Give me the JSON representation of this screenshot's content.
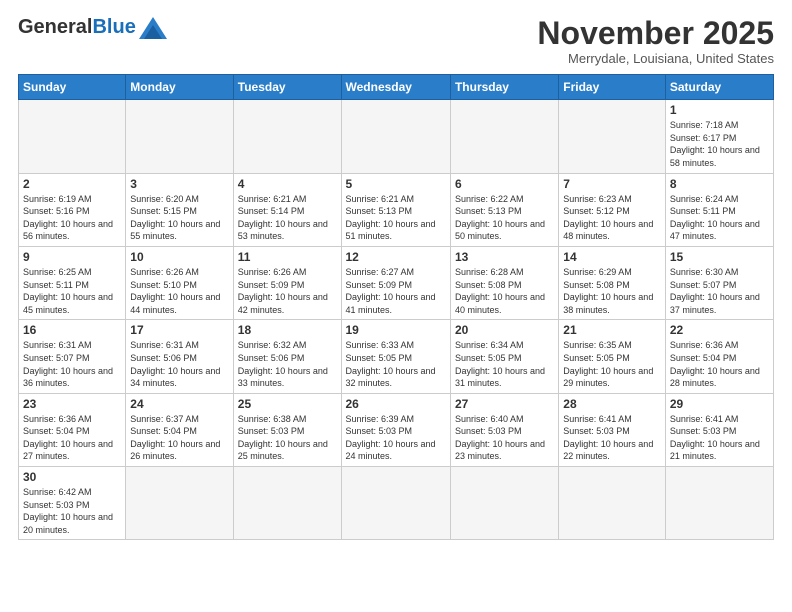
{
  "header": {
    "logo_general": "General",
    "logo_blue": "Blue",
    "month_title": "November 2025",
    "location": "Merrydale, Louisiana, United States"
  },
  "weekdays": [
    "Sunday",
    "Monday",
    "Tuesday",
    "Wednesday",
    "Thursday",
    "Friday",
    "Saturday"
  ],
  "days": {
    "d1": {
      "num": "1",
      "rise": "Sunrise: 7:18 AM",
      "set": "Sunset: 6:17 PM",
      "day": "Daylight: 10 hours and 58 minutes."
    },
    "d2": {
      "num": "2",
      "rise": "Sunrise: 6:19 AM",
      "set": "Sunset: 5:16 PM",
      "day": "Daylight: 10 hours and 56 minutes."
    },
    "d3": {
      "num": "3",
      "rise": "Sunrise: 6:20 AM",
      "set": "Sunset: 5:15 PM",
      "day": "Daylight: 10 hours and 55 minutes."
    },
    "d4": {
      "num": "4",
      "rise": "Sunrise: 6:21 AM",
      "set": "Sunset: 5:14 PM",
      "day": "Daylight: 10 hours and 53 minutes."
    },
    "d5": {
      "num": "5",
      "rise": "Sunrise: 6:21 AM",
      "set": "Sunset: 5:13 PM",
      "day": "Daylight: 10 hours and 51 minutes."
    },
    "d6": {
      "num": "6",
      "rise": "Sunrise: 6:22 AM",
      "set": "Sunset: 5:13 PM",
      "day": "Daylight: 10 hours and 50 minutes."
    },
    "d7": {
      "num": "7",
      "rise": "Sunrise: 6:23 AM",
      "set": "Sunset: 5:12 PM",
      "day": "Daylight: 10 hours and 48 minutes."
    },
    "d8": {
      "num": "8",
      "rise": "Sunrise: 6:24 AM",
      "set": "Sunset: 5:11 PM",
      "day": "Daylight: 10 hours and 47 minutes."
    },
    "d9": {
      "num": "9",
      "rise": "Sunrise: 6:25 AM",
      "set": "Sunset: 5:11 PM",
      "day": "Daylight: 10 hours and 45 minutes."
    },
    "d10": {
      "num": "10",
      "rise": "Sunrise: 6:26 AM",
      "set": "Sunset: 5:10 PM",
      "day": "Daylight: 10 hours and 44 minutes."
    },
    "d11": {
      "num": "11",
      "rise": "Sunrise: 6:26 AM",
      "set": "Sunset: 5:09 PM",
      "day": "Daylight: 10 hours and 42 minutes."
    },
    "d12": {
      "num": "12",
      "rise": "Sunrise: 6:27 AM",
      "set": "Sunset: 5:09 PM",
      "day": "Daylight: 10 hours and 41 minutes."
    },
    "d13": {
      "num": "13",
      "rise": "Sunrise: 6:28 AM",
      "set": "Sunset: 5:08 PM",
      "day": "Daylight: 10 hours and 40 minutes."
    },
    "d14": {
      "num": "14",
      "rise": "Sunrise: 6:29 AM",
      "set": "Sunset: 5:08 PM",
      "day": "Daylight: 10 hours and 38 minutes."
    },
    "d15": {
      "num": "15",
      "rise": "Sunrise: 6:30 AM",
      "set": "Sunset: 5:07 PM",
      "day": "Daylight: 10 hours and 37 minutes."
    },
    "d16": {
      "num": "16",
      "rise": "Sunrise: 6:31 AM",
      "set": "Sunset: 5:07 PM",
      "day": "Daylight: 10 hours and 36 minutes."
    },
    "d17": {
      "num": "17",
      "rise": "Sunrise: 6:31 AM",
      "set": "Sunset: 5:06 PM",
      "day": "Daylight: 10 hours and 34 minutes."
    },
    "d18": {
      "num": "18",
      "rise": "Sunrise: 6:32 AM",
      "set": "Sunset: 5:06 PM",
      "day": "Daylight: 10 hours and 33 minutes."
    },
    "d19": {
      "num": "19",
      "rise": "Sunrise: 6:33 AM",
      "set": "Sunset: 5:05 PM",
      "day": "Daylight: 10 hours and 32 minutes."
    },
    "d20": {
      "num": "20",
      "rise": "Sunrise: 6:34 AM",
      "set": "Sunset: 5:05 PM",
      "day": "Daylight: 10 hours and 31 minutes."
    },
    "d21": {
      "num": "21",
      "rise": "Sunrise: 6:35 AM",
      "set": "Sunset: 5:05 PM",
      "day": "Daylight: 10 hours and 29 minutes."
    },
    "d22": {
      "num": "22",
      "rise": "Sunrise: 6:36 AM",
      "set": "Sunset: 5:04 PM",
      "day": "Daylight: 10 hours and 28 minutes."
    },
    "d23": {
      "num": "23",
      "rise": "Sunrise: 6:36 AM",
      "set": "Sunset: 5:04 PM",
      "day": "Daylight: 10 hours and 27 minutes."
    },
    "d24": {
      "num": "24",
      "rise": "Sunrise: 6:37 AM",
      "set": "Sunset: 5:04 PM",
      "day": "Daylight: 10 hours and 26 minutes."
    },
    "d25": {
      "num": "25",
      "rise": "Sunrise: 6:38 AM",
      "set": "Sunset: 5:03 PM",
      "day": "Daylight: 10 hours and 25 minutes."
    },
    "d26": {
      "num": "26",
      "rise": "Sunrise: 6:39 AM",
      "set": "Sunset: 5:03 PM",
      "day": "Daylight: 10 hours and 24 minutes."
    },
    "d27": {
      "num": "27",
      "rise": "Sunrise: 6:40 AM",
      "set": "Sunset: 5:03 PM",
      "day": "Daylight: 10 hours and 23 minutes."
    },
    "d28": {
      "num": "28",
      "rise": "Sunrise: 6:41 AM",
      "set": "Sunset: 5:03 PM",
      "day": "Daylight: 10 hours and 22 minutes."
    },
    "d29": {
      "num": "29",
      "rise": "Sunrise: 6:41 AM",
      "set": "Sunset: 5:03 PM",
      "day": "Daylight: 10 hours and 21 minutes."
    },
    "d30": {
      "num": "30",
      "rise": "Sunrise: 6:42 AM",
      "set": "Sunset: 5:03 PM",
      "day": "Daylight: 10 hours and 20 minutes."
    }
  }
}
